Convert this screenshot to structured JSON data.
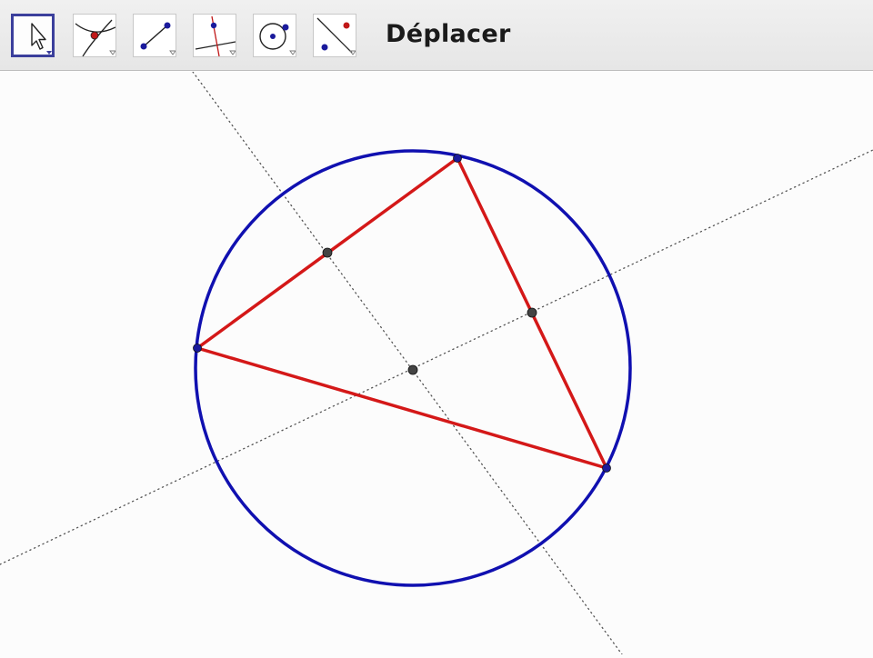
{
  "toolbar": {
    "current_tool_label": "Déplacer",
    "tools": [
      {
        "name": "move-tool-button",
        "selected": true
      },
      {
        "name": "intersect-point-tool-button",
        "selected": false
      },
      {
        "name": "segment-tool-button",
        "selected": false
      },
      {
        "name": "perpendicular-bisector-tool-button",
        "selected": false
      },
      {
        "name": "circle-center-point-tool-button",
        "selected": false
      },
      {
        "name": "reflect-tool-button",
        "selected": false
      }
    ]
  },
  "construction": {
    "circle_color": "#1010b0",
    "triangle_color": "#d41818",
    "point_color": "#404040",
    "bisector_style": "dotted"
  },
  "colors": {
    "accent": "#3b3f9c",
    "point_blue": "#1a1a9c",
    "point_red": "#c01818"
  }
}
